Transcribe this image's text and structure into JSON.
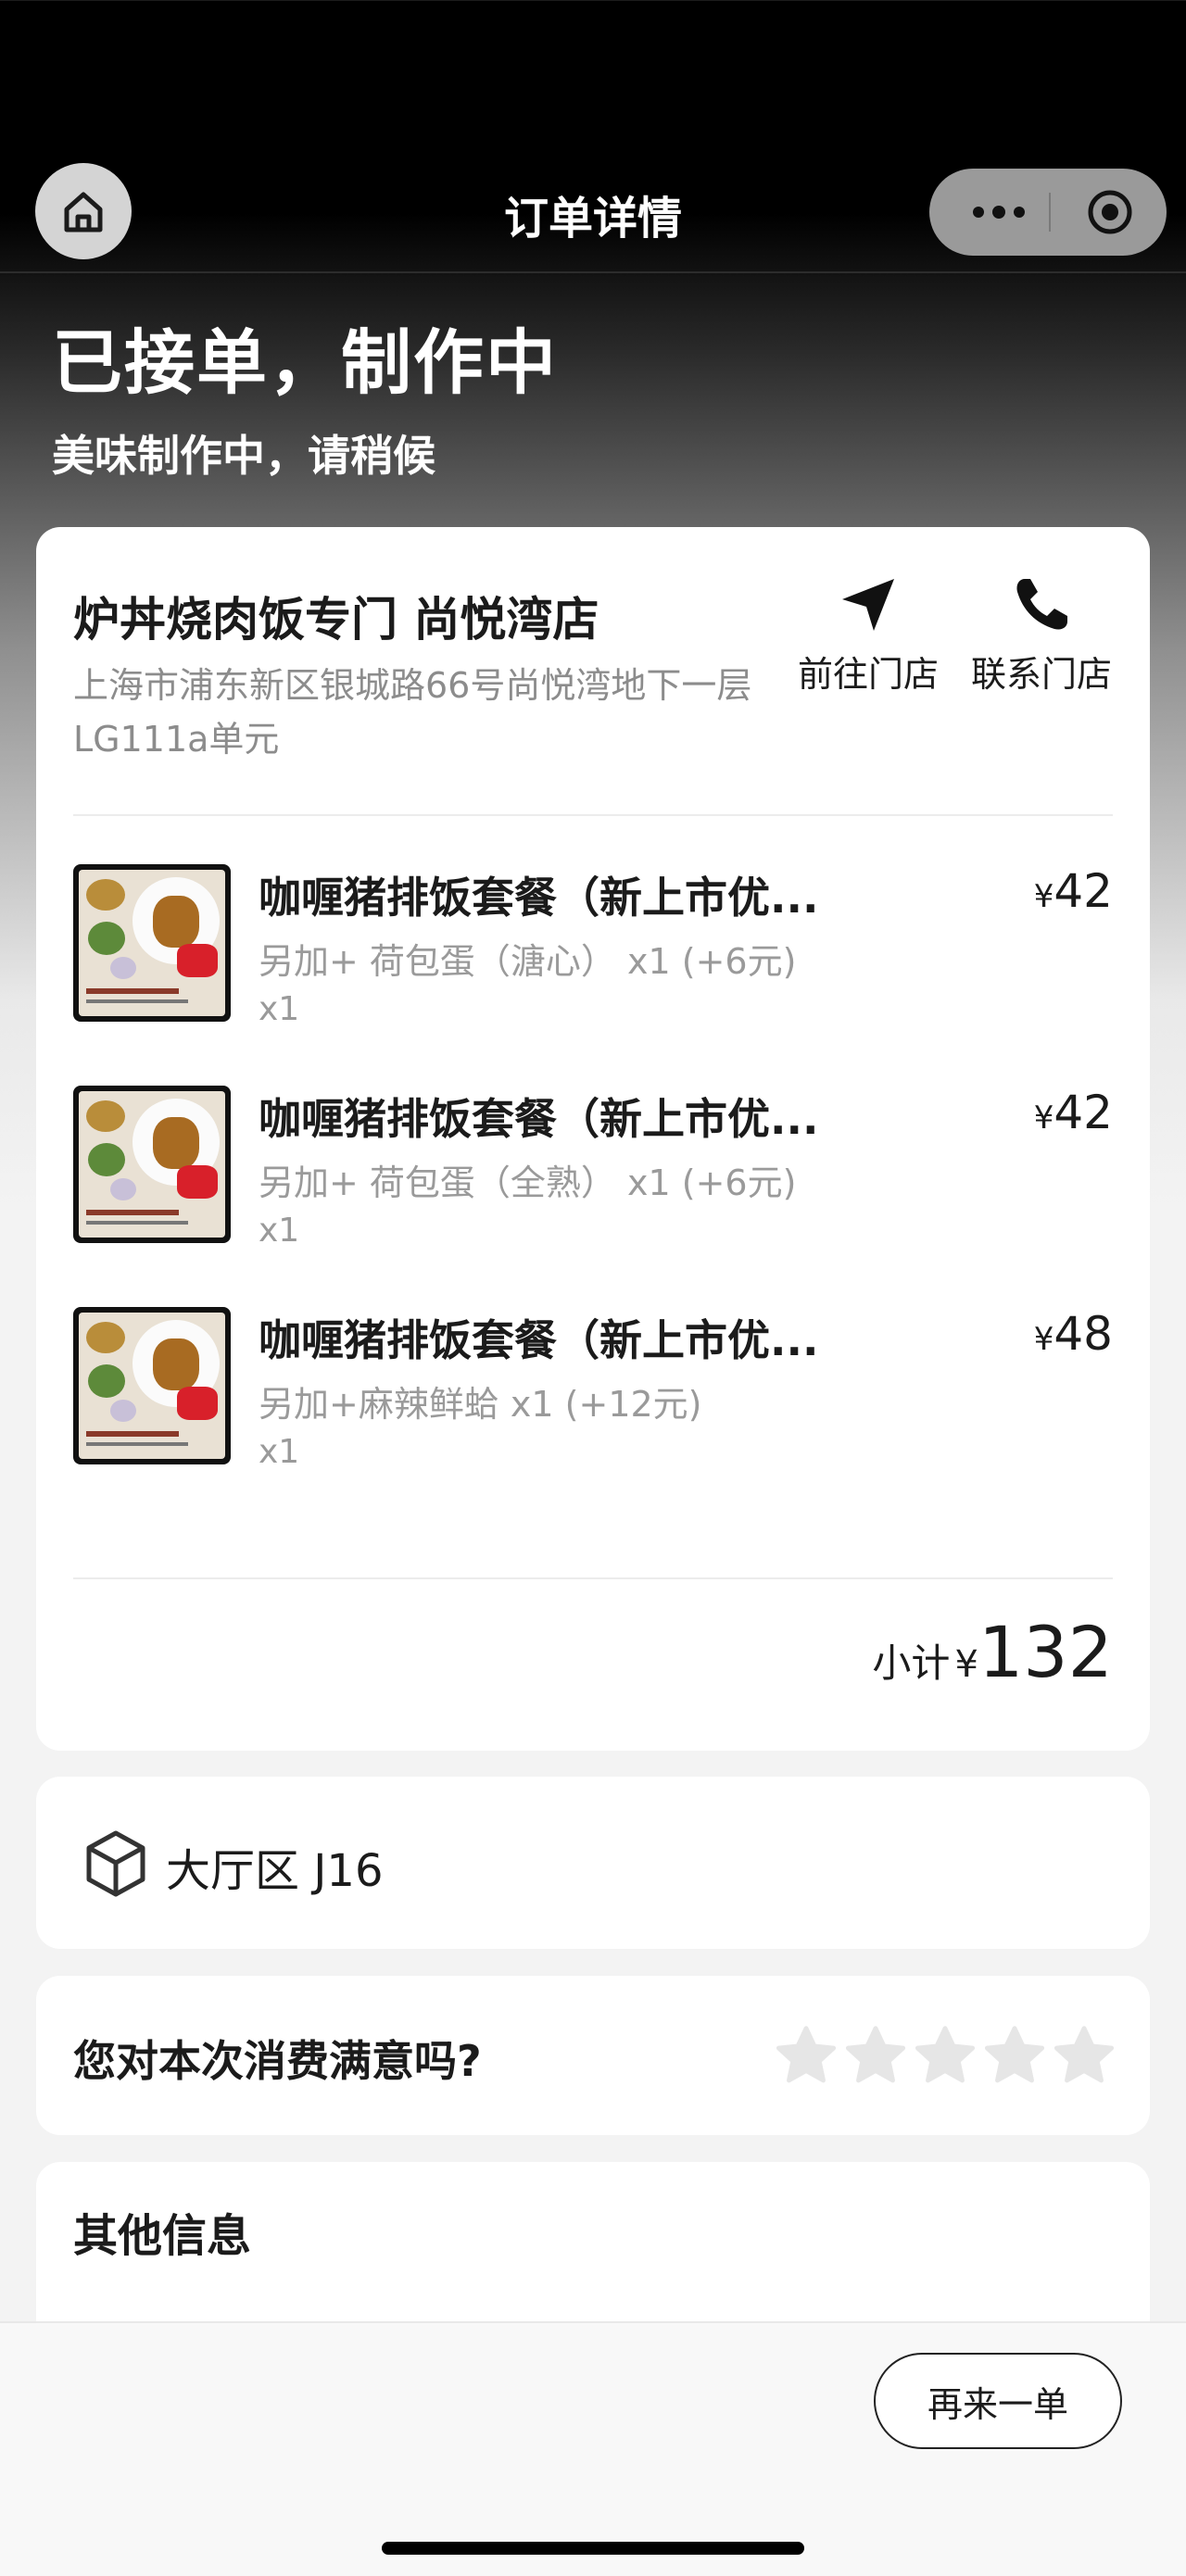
{
  "nav": {
    "title": "订单详情",
    "icons": {
      "home": "home-icon",
      "more": "more-dots-icon",
      "close": "target-icon"
    }
  },
  "status": {
    "title": "已接单，制作中",
    "subtitle": "美味制作中，请稍候"
  },
  "store": {
    "name": "炉丼烧肉饭专门 尚悦湾店",
    "address": "上海市浦东新区银城路66号尚悦湾地下一层LG111a单元",
    "actions": [
      {
        "label": "前往门店",
        "icon": "navigation-arrow-icon"
      },
      {
        "label": "联系门店",
        "icon": "phone-icon"
      }
    ]
  },
  "items": [
    {
      "name": "咖喱猪排饭套餐（新上市优...",
      "option": "另加+ 荷包蛋（溏心） x1 (+6元)",
      "qty": "x1",
      "currency": "¥",
      "price": "42"
    },
    {
      "name": "咖喱猪排饭套餐（新上市优...",
      "option": "另加+ 荷包蛋（全熟） x1 (+6元)",
      "qty": "x1",
      "currency": "¥",
      "price": "42"
    },
    {
      "name": "咖喱猪排饭套餐（新上市优...",
      "option": "另加+麻辣鲜蛤 x1 (+12元)",
      "qty": "x1",
      "currency": "¥",
      "price": "48"
    }
  ],
  "subtotal": {
    "label": "小计",
    "currency": "¥",
    "amount": "132"
  },
  "table": {
    "label": "大厅区 J16",
    "icon": "cube-icon"
  },
  "rating": {
    "question": "您对本次消费满意吗?",
    "max_stars": 5,
    "selected": 0,
    "star_color": "#e6e6e6"
  },
  "other_info": {
    "title": "其他信息"
  },
  "actions": {
    "reorder_label": "再来一单"
  }
}
